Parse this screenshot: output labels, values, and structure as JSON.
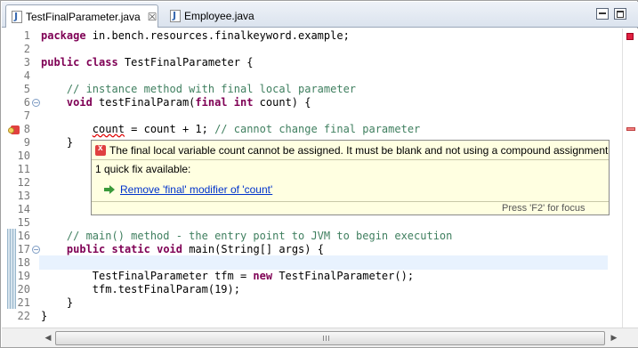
{
  "tabs": [
    {
      "label": "TestFinalParameter.java",
      "close": "☒",
      "icon": "java-file-icon"
    },
    {
      "label": "Employee.java",
      "icon": "java-file-icon"
    }
  ],
  "window_controls": {
    "minimize": "minimize-icon",
    "maximize": "maximize-icon"
  },
  "code_lines": [
    {
      "n": "1",
      "text": "package in.bench.resources.finalkeyword.example;"
    },
    {
      "n": "2",
      "text": ""
    },
    {
      "n": "3",
      "text": "public class TestFinalParameter {"
    },
    {
      "n": "4",
      "text": ""
    },
    {
      "n": "5",
      "text": "    // instance method with final local parameter"
    },
    {
      "n": "6",
      "text": "    void testFinalParam(final int count) {"
    },
    {
      "n": "7",
      "text": ""
    },
    {
      "n": "8",
      "text": "        count = count + 1; // cannot change final parameter"
    },
    {
      "n": "9",
      "text": "    }"
    },
    {
      "n": "10",
      "text": ""
    },
    {
      "n": "11",
      "text": ""
    },
    {
      "n": "12",
      "text": ""
    },
    {
      "n": "13",
      "text": ""
    },
    {
      "n": "14",
      "text": ""
    },
    {
      "n": "15",
      "text": ""
    },
    {
      "n": "16",
      "text": "    // main() method - the entry point to JVM to begin execution"
    },
    {
      "n": "17",
      "text": "    public static void main(String[] args) {"
    },
    {
      "n": "18",
      "text": ""
    },
    {
      "n": "19",
      "text": "        TestFinalParameter tfm = new TestFinalParameter();"
    },
    {
      "n": "20",
      "text": "        tfm.testFinalParam(19);"
    },
    {
      "n": "21",
      "text": "    }"
    },
    {
      "n": "22",
      "text": "}"
    }
  ],
  "popup": {
    "message": "The final local variable count cannot be assigned. It must be blank and not using a compound assignment",
    "count": "1 quick fix available:",
    "fix": "Remove 'final' modifier of 'count'",
    "footer": "Press 'F2' for focus"
  },
  "scrollbar": {
    "left_arrow": "◀",
    "right_arrow": "▶"
  },
  "colors": {
    "keyword": "#7f0055",
    "comment": "#3f7f5f",
    "error": "#e00000",
    "popup_bg": "#ffffe1",
    "link": "#0033cc"
  }
}
